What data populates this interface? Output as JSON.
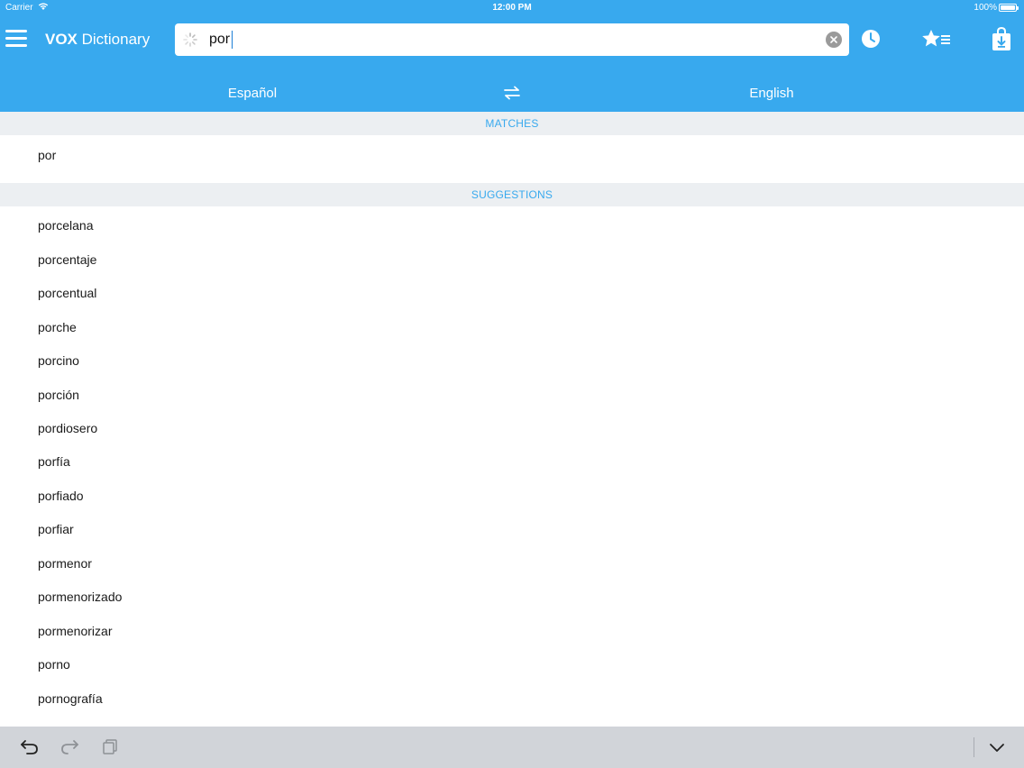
{
  "status_bar": {
    "carrier": "Carrier",
    "time": "12:00 PM",
    "battery": "100%"
  },
  "app": {
    "title_bold": "VOX",
    "title_rest": " Dictionary"
  },
  "search": {
    "query": "por",
    "placeholder": ""
  },
  "languages": {
    "source": "Español",
    "target": "English"
  },
  "sections": {
    "matches": "MATCHES",
    "suggestions": "SUGGESTIONS"
  },
  "matches": [
    "por"
  ],
  "suggestions": [
    "porcelana",
    "porcentaje",
    "porcentual",
    "porche",
    "porcino",
    "porción",
    "pordiosero",
    "porfía",
    "porfiado",
    "porfiar",
    "pormenor",
    "pormenorizado",
    "pormenorizar",
    "porno",
    "pornografía"
  ],
  "icons": {
    "menu": "hamburger-menu-icon",
    "loading": "spinner-icon",
    "clear": "clear-x-icon",
    "history": "clock-icon",
    "favorites": "star-list-icon",
    "store": "download-bag-icon",
    "swap": "swap-arrows-icon",
    "undo": "undo-icon",
    "redo": "redo-icon",
    "paste": "paste-icon",
    "dismiss_keyboard": "chevron-down-icon"
  },
  "colors": {
    "brand": "#38a9ee",
    "section_bg": "#eceff2",
    "toolbar_bg": "#d1d4d9"
  }
}
